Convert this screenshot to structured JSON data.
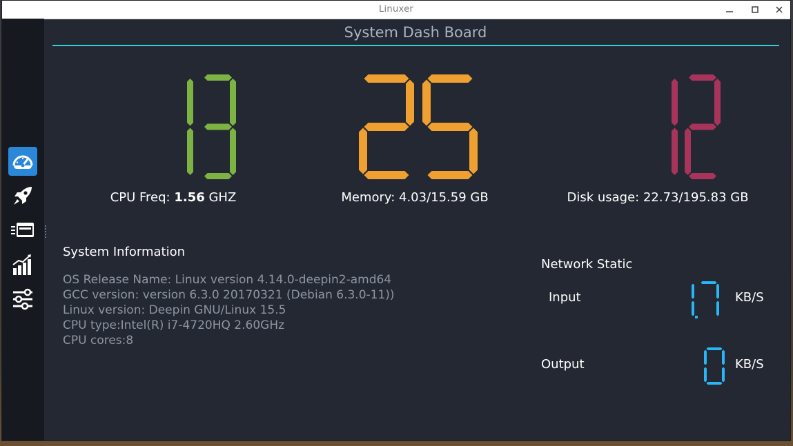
{
  "window": {
    "title": "Linuxer"
  },
  "header": {
    "title": "System Dash Board"
  },
  "sidebar": {
    "items": [
      {
        "name": "dashboard",
        "icon": "speedometer-icon",
        "active": true
      },
      {
        "name": "rocket",
        "icon": "rocket-icon",
        "active": false
      },
      {
        "name": "process",
        "icon": "window-stack-icon",
        "active": false
      },
      {
        "name": "stats",
        "icon": "bar-chart-icon",
        "active": false
      },
      {
        "name": "settings",
        "icon": "sliders-icon",
        "active": false
      }
    ]
  },
  "stats": {
    "cpu": {
      "digits": "13",
      "color": "#7cb342",
      "label_prefix": "CPU Freq: ",
      "label_value": "1.56",
      "label_suffix": " GHZ"
    },
    "memory": {
      "digits": "25",
      "color": "#f0a030",
      "label": "Memory: 4.03/15.59 GB"
    },
    "disk": {
      "digits": "12",
      "color": "#a8345c",
      "label": "Disk usage: 22.73/195.83 GB"
    }
  },
  "system_info": {
    "title": "System Information",
    "lines": [
      "OS Release Name: Linux version 4.14.0-deepin2-amd64",
      "GCC version: version 6.3.0 20170321 (Debian 6.3.0-11))",
      "Linux version: Deepin GNU/Linux 15.5",
      "CPU type:Intel(R) i7-4720HQ 2.60GHz",
      "CPU cores:8"
    ]
  },
  "network": {
    "title": "Network Static",
    "input": {
      "label": "Input",
      "value": "1.7",
      "unit": "KB/S"
    },
    "output": {
      "label": "Output",
      "value": "0",
      "unit": "KB/S"
    },
    "color": "#29b6f6"
  }
}
